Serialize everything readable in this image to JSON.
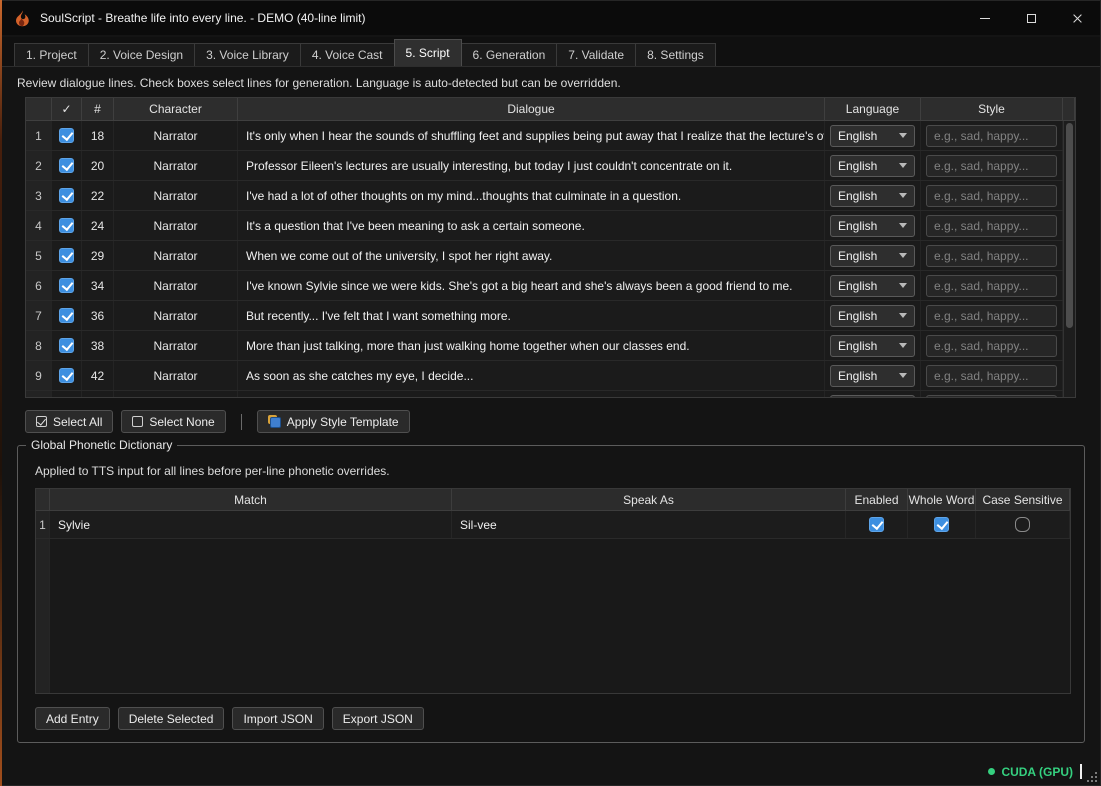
{
  "window": {
    "title": "SoulScript - Breathe life into every line. - DEMO (40-line limit)"
  },
  "tabs": [
    {
      "label": "1. Project",
      "active": false
    },
    {
      "label": "2. Voice Design",
      "active": false
    },
    {
      "label": "3. Voice Library",
      "active": false
    },
    {
      "label": "4. Voice Cast",
      "active": false
    },
    {
      "label": "5. Script",
      "active": true
    },
    {
      "label": "6. Generation",
      "active": false
    },
    {
      "label": "7. Validate",
      "active": false
    },
    {
      "label": "8. Settings",
      "active": false
    }
  ],
  "script": {
    "instructions": "Review dialogue lines. Check boxes select lines for generation. Language is auto-detected but can be overridden.",
    "table": {
      "headers": {
        "check": "✓",
        "number": "#",
        "character": "Character",
        "dialogue": "Dialogue",
        "language": "Language",
        "style": "Style"
      },
      "style_placeholder": "e.g., sad, happy...",
      "rows": [
        {
          "row": 1,
          "checked": true,
          "number": 18,
          "character": "Narrator",
          "dialogue": "It's only when I hear the sounds of shuffling feet and supplies being put away that I realize that the lecture's over.",
          "language": "English",
          "style": ""
        },
        {
          "row": 2,
          "checked": true,
          "number": 20,
          "character": "Narrator",
          "dialogue": "Professor Eileen's lectures are usually interesting, but today I just couldn't concentrate on it.",
          "language": "English",
          "style": ""
        },
        {
          "row": 3,
          "checked": true,
          "number": 22,
          "character": "Narrator",
          "dialogue": "I've had a lot of other thoughts on my mind...thoughts that culminate in a question.",
          "language": "English",
          "style": ""
        },
        {
          "row": 4,
          "checked": true,
          "number": 24,
          "character": "Narrator",
          "dialogue": "It's a question that I've been meaning to ask a certain someone.",
          "language": "English",
          "style": ""
        },
        {
          "row": 5,
          "checked": true,
          "number": 29,
          "character": "Narrator",
          "dialogue": "When we come out of the university, I spot her right away.",
          "language": "English",
          "style": ""
        },
        {
          "row": 6,
          "checked": true,
          "number": 34,
          "character": "Narrator",
          "dialogue": "I've known Sylvie since we were kids. She's got a big heart and she's always been a good friend to me.",
          "language": "English",
          "style": ""
        },
        {
          "row": 7,
          "checked": true,
          "number": 36,
          "character": "Narrator",
          "dialogue": "But recently... I've felt that I want something more.",
          "language": "English",
          "style": ""
        },
        {
          "row": 8,
          "checked": true,
          "number": 38,
          "character": "Narrator",
          "dialogue": "More than just talking, more than just walking home together when our classes end.",
          "language": "English",
          "style": ""
        },
        {
          "row": 9,
          "checked": true,
          "number": 42,
          "character": "Narrator",
          "dialogue": "As soon as she catches my eye, I decide...",
          "language": "English",
          "style": ""
        }
      ],
      "partial_row_visible": true
    },
    "toolbar": {
      "select_all": "Select All",
      "select_none": "Select None",
      "apply_style_template": "Apply Style Template"
    }
  },
  "phonetic": {
    "title": "Global Phonetic Dictionary",
    "description": "Applied to TTS input for all lines before per-line phonetic overrides.",
    "headers": [
      "Match",
      "Speak As",
      "Enabled",
      "Whole Word",
      "Case Sensitive"
    ],
    "rows": [
      {
        "row": 1,
        "match": "Sylvie",
        "speak_as": "Sil-vee",
        "enabled": true,
        "whole_word": true,
        "case_sensitive": false
      }
    ],
    "buttons": {
      "add_entry": "Add Entry",
      "delete_selected": "Delete Selected",
      "import_json": "Import JSON",
      "export_json": "Export JSON"
    }
  },
  "status": {
    "device": "CUDA (GPU)"
  },
  "colors": {
    "checkbox_blue": "#3d8fe0",
    "status_green": "#35d07f",
    "flame_orange": "#d4622a"
  }
}
